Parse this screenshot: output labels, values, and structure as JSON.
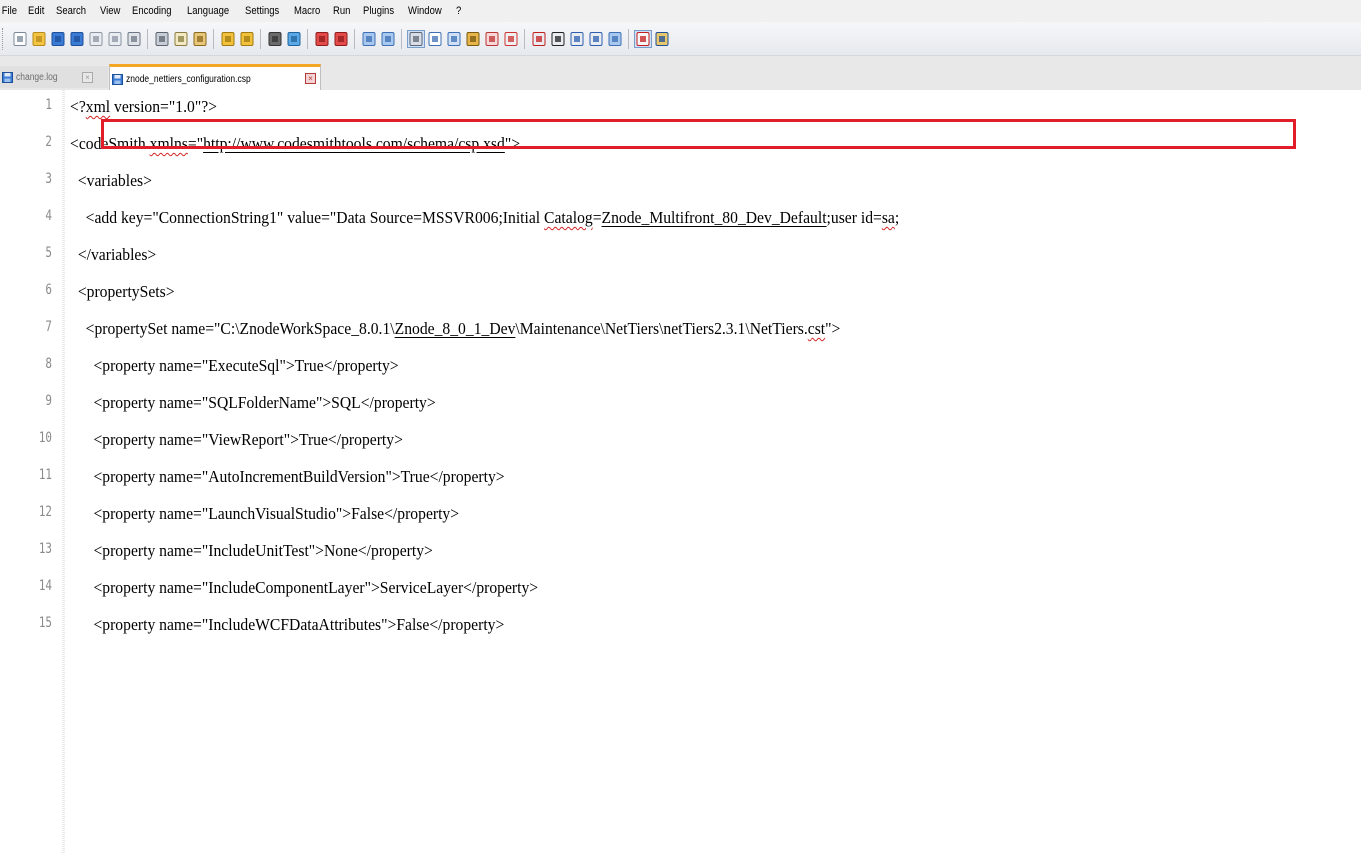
{
  "menu": [
    "File",
    "Edit",
    "Search",
    "View",
    "Encoding",
    "Language",
    "Settings",
    "Macro",
    "Run",
    "Plugins",
    "Window",
    "?"
  ],
  "toolbar_icons": [
    "new-file-icon",
    "open-file-icon",
    "save-icon",
    "save-all-icon",
    "close-icon",
    "close-all-icon",
    "print-icon",
    "|",
    "cut-icon",
    "copy-icon",
    "paste-icon",
    "|",
    "undo-icon",
    "redo-icon",
    "|",
    "find-icon",
    "replace-icon",
    "|",
    "zoom-in-icon",
    "zoom-out-icon",
    "|",
    "sync-vertical-scroll-icon",
    "sync-horizontal-scroll-icon",
    "|",
    "word-wrap-icon",
    "show-all-characters-icon",
    "indent-guide-icon",
    "user-defined-language-icon",
    "document-map-icon",
    "function-list-icon",
    "|",
    "record-macro-icon",
    "stop-recording-icon",
    "playback-macro-icon",
    "run-macro-multiple-icon",
    "save-macro-icon",
    "|",
    "spell-check-icon",
    "spell-check-settings-icon"
  ],
  "tabs": {
    "inactive": {
      "label": "change.log"
    },
    "active": {
      "label": "znode_nettiers_configuration.csp"
    }
  },
  "lines": [
    {
      "num": "1",
      "text": "<?xml version=\"1.0\"?>"
    },
    {
      "num": "2",
      "text": "<codeSmith xmlns=\"http://www.codesmithtools.com/schema/csp.xsd\">"
    },
    {
      "num": "3",
      "text": "  <variables>"
    },
    {
      "num": "4",
      "text": "    <add key=\"ConnectionString1\" value=\"Data Source=MSSVR006;Initial Catalog=Znode_Multifront_80_Dev_Default;user id=sa;"
    },
    {
      "num": "5",
      "text": "  </variables>"
    },
    {
      "num": "6",
      "text": "  <propertySets>"
    },
    {
      "num": "7",
      "text": "    <propertySet name=\"C:\\ZnodeWorkSpace_8.0.1\\Znode_8_0_1_Dev\\Maintenance\\NetTiers\\netTiers2.3.1\\NetTiers.cst\">"
    },
    {
      "num": "8",
      "text": "      <property name=\"ExecuteSql\">True</property>"
    },
    {
      "num": "9",
      "text": "      <property name=\"SQLFolderName\">SQL</property>"
    },
    {
      "num": "10",
      "text": "      <property name=\"ViewReport\">True</property>"
    },
    {
      "num": "11",
      "text": "      <property name=\"AutoIncrementBuildVersion\">True</property>"
    },
    {
      "num": "12",
      "text": "      <property name=\"LaunchVisualStudio\">False</property>"
    },
    {
      "num": "13",
      "text": "      <property name=\"IncludeUnitTest\">None</property>"
    },
    {
      "num": "14",
      "text": "      <property name=\"IncludeComponentLayer\">ServiceLayer</property>"
    },
    {
      "num": "15",
      "text": "      <property name=\"IncludeWCFDataAttributes\">False</property>"
    }
  ],
  "highlight_color": "#e11d2a",
  "active_tab_accent": "#f5a623"
}
